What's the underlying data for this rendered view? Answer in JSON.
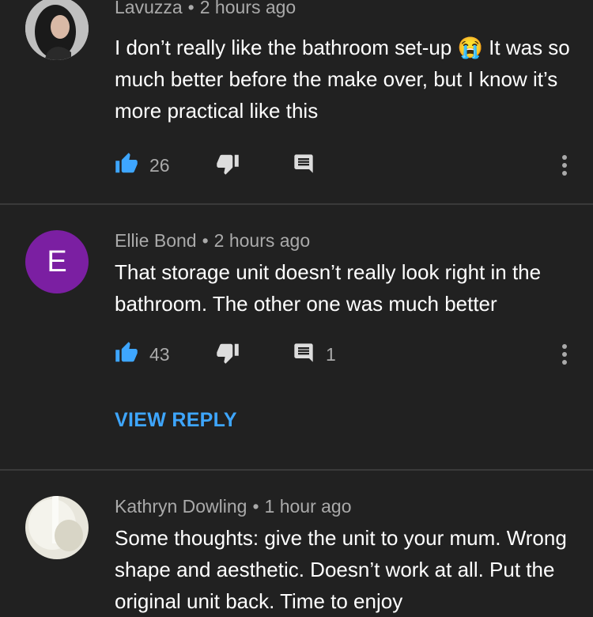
{
  "comments": [
    {
      "author": "Lavuzza",
      "time": "2 hours ago",
      "text_part1": "I don’t really like the bathroom set-up",
      "emoji": "😭",
      "text_part2": " It was so much better before the make over, but I know it’s more practical like this",
      "likes": "26",
      "replies": ""
    },
    {
      "author": "Ellie Bond",
      "avatar_letter": "E",
      "avatar_color": "#7b1fa2",
      "time": "2 hours ago",
      "text": "That storage unit doesn’t really look right in the bathroom. The other one was much better",
      "likes": "43",
      "replies": "1",
      "view_reply": "VIEW REPLY"
    },
    {
      "author": "Kathryn Dowling",
      "time": "1 hour ago",
      "text": "Some thoughts: give the unit to your mum. Wrong shape and aesthetic. Doesn’t work at all. Put the original unit back. Time to enjoy"
    }
  ],
  "colors": {
    "background": "#212121",
    "like_active": "#3ea6ff",
    "link": "#3ea6ff",
    "muted": "#aaaaaa"
  },
  "icons": [
    "thumbs-up-icon",
    "thumbs-down-icon",
    "reply-icon",
    "more-vert-icon"
  ]
}
